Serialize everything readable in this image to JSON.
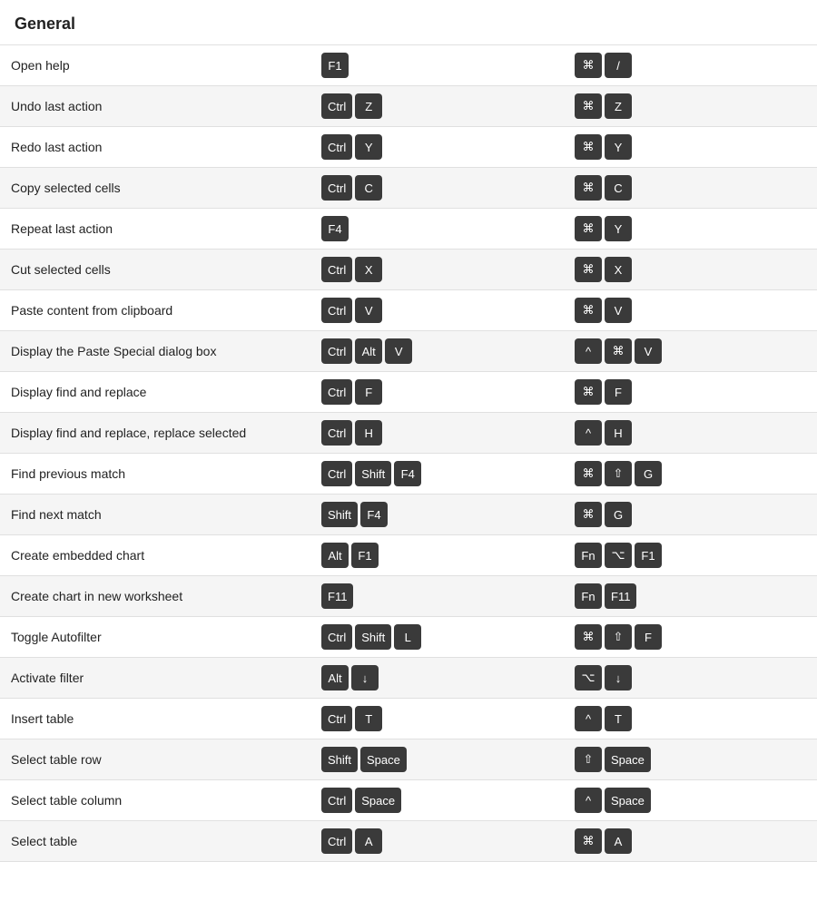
{
  "section": {
    "title": "General"
  },
  "rows": [
    {
      "action": "Open help",
      "win_keys": [
        "F1"
      ],
      "mac_keys": [
        "⌘",
        "/"
      ]
    },
    {
      "action": "Undo last action",
      "win_keys": [
        "Ctrl",
        "Z"
      ],
      "mac_keys": [
        "⌘",
        "Z"
      ]
    },
    {
      "action": "Redo last action",
      "win_keys": [
        "Ctrl",
        "Y"
      ],
      "mac_keys": [
        "⌘",
        "Y"
      ]
    },
    {
      "action": "Copy selected cells",
      "win_keys": [
        "Ctrl",
        "C"
      ],
      "mac_keys": [
        "⌘",
        "C"
      ]
    },
    {
      "action": "Repeat last action",
      "win_keys": [
        "F4"
      ],
      "mac_keys": [
        "⌘",
        "Y"
      ]
    },
    {
      "action": "Cut selected cells",
      "win_keys": [
        "Ctrl",
        "X"
      ],
      "mac_keys": [
        "⌘",
        "X"
      ]
    },
    {
      "action": "Paste content from clipboard",
      "win_keys": [
        "Ctrl",
        "V"
      ],
      "mac_keys": [
        "⌘",
        "V"
      ]
    },
    {
      "action": "Display the Paste Special dialog box",
      "win_keys": [
        "Ctrl",
        "Alt",
        "V"
      ],
      "mac_keys": [
        "^",
        "⌘",
        "V"
      ]
    },
    {
      "action": "Display find and replace",
      "win_keys": [
        "Ctrl",
        "F"
      ],
      "mac_keys": [
        "⌘",
        "F"
      ]
    },
    {
      "action": "Display find and replace, replace selected",
      "win_keys": [
        "Ctrl",
        "H"
      ],
      "mac_keys": [
        "^",
        "H"
      ]
    },
    {
      "action": "Find previous match",
      "win_keys": [
        "Ctrl",
        "Shift",
        "F4"
      ],
      "mac_keys": [
        "⌘",
        "⇧",
        "G"
      ]
    },
    {
      "action": "Find next match",
      "win_keys": [
        "Shift",
        "F4"
      ],
      "mac_keys": [
        "⌘",
        "G"
      ]
    },
    {
      "action": "Create embedded chart",
      "win_keys": [
        "Alt",
        "F1"
      ],
      "mac_keys": [
        "Fn",
        "⌥",
        "F1"
      ]
    },
    {
      "action": "Create chart in new worksheet",
      "win_keys": [
        "F11"
      ],
      "mac_keys": [
        "Fn",
        "F11"
      ]
    },
    {
      "action": "Toggle Autofilter",
      "win_keys": [
        "Ctrl",
        "Shift",
        "L"
      ],
      "mac_keys": [
        "⌘",
        "⇧",
        "F"
      ]
    },
    {
      "action": "Activate filter",
      "win_keys": [
        "Alt",
        "↓"
      ],
      "mac_keys": [
        "⌥",
        "↓"
      ]
    },
    {
      "action": "Insert table",
      "win_keys": [
        "Ctrl",
        "T"
      ],
      "mac_keys": [
        "^",
        "T"
      ]
    },
    {
      "action": "Select table row",
      "win_keys": [
        "Shift",
        "Space"
      ],
      "mac_keys": [
        "⇧",
        "Space"
      ]
    },
    {
      "action": "Select table column",
      "win_keys": [
        "Ctrl",
        "Space"
      ],
      "mac_keys": [
        "^",
        "Space"
      ]
    },
    {
      "action": "Select table",
      "win_keys": [
        "Ctrl",
        "A"
      ],
      "mac_keys": [
        "⌘",
        "A"
      ]
    }
  ]
}
